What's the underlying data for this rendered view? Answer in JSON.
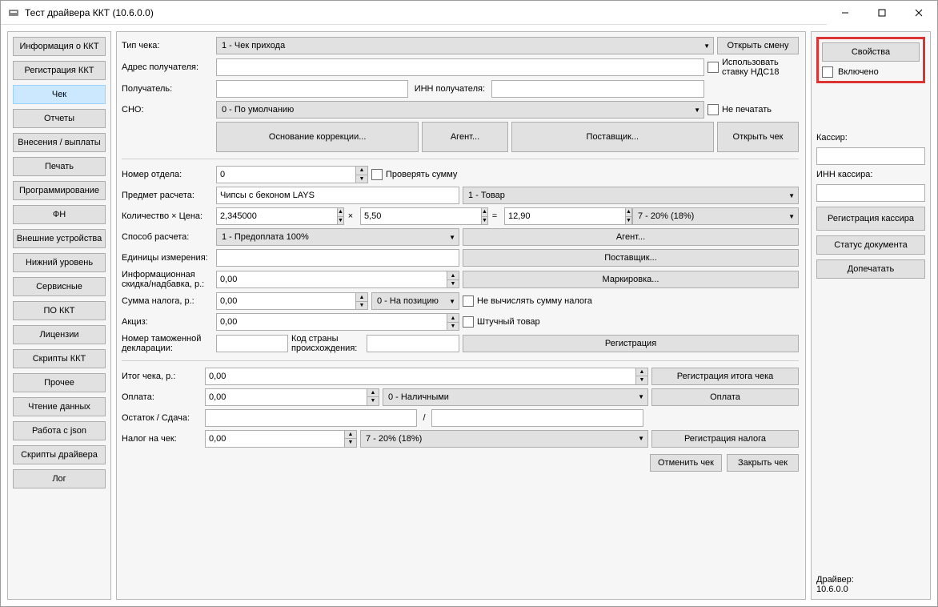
{
  "window": {
    "title": "Тест драйвера ККТ (10.6.0.0)"
  },
  "sidebar": {
    "items": [
      "Информация о ККТ",
      "Регистрация ККТ",
      "Чек",
      "Отчеты",
      "Внесения / выплаты",
      "Печать",
      "Программирование",
      "ФН",
      "Внешние устройства",
      "Нижний уровень",
      "Сервисные",
      "ПО ККТ",
      "Лицензии",
      "Скрипты ККТ",
      "Прочее",
      "Чтение данных",
      "Работа с json",
      "Скрипты драйвера",
      "Лог"
    ],
    "active_index": 2
  },
  "main": {
    "labels": {
      "check_type": "Тип чека:",
      "recipient_address": "Адрес получателя:",
      "recipient": "Получатель:",
      "recipient_inn": "ИНН получателя:",
      "sno": "СНО:",
      "use_vat18": "Использовать ставку НДС18",
      "no_print": "Не печатать",
      "dept_number": "Номер отдела:",
      "check_sum": "Проверять сумму",
      "item_subject": "Предмет расчета:",
      "qty_price": "Количество × Цена:",
      "calc_method": "Способ расчета:",
      "units": "Единицы измерения:",
      "info_discount": "Информационная скидка/надбавка, р.:",
      "tax_sum": "Сумма налога, р.:",
      "no_calc_tax": "Не вычислять сумму налога",
      "excise": "Акциз:",
      "piece_goods": "Штучный товар",
      "customs_decl": "Номер таможенной декларации:",
      "country_code": "Код страны происхождения:",
      "check_total": "Итог чека, р.:",
      "payment": "Оплата:",
      "remainder": "Остаток / Сдача:",
      "check_tax": "Налог на чек:"
    },
    "values": {
      "check_type": "1 - Чек прихода",
      "recipient_address": "",
      "recipient": "",
      "recipient_inn": "",
      "sno": "0 - По умолчанию",
      "dept_number": "0",
      "item_subject": "Чипсы с беконом LAYS",
      "item_type": "1 - Товар",
      "quantity": "2,345000",
      "price": "5,50",
      "total": "12,90",
      "vat_rate": "7 - 20% (18%)",
      "calc_method": "1 - Предоплата 100%",
      "units": "",
      "info_discount": "0,00",
      "tax_sum": "0,00",
      "tax_pos": "0 - На позицию",
      "excise": "0,00",
      "customs_decl": "",
      "country_code": "",
      "check_total": "0,00",
      "payment": "0,00",
      "payment_type": "0 - Наличными",
      "remainder1": "",
      "remainder2": "",
      "check_tax": "0,00",
      "check_tax_type": "7 - 20% (18%)"
    },
    "buttons": {
      "open_shift": "Открыть смену",
      "correction_basis": "Основание коррекции...",
      "agent_top": "Агент...",
      "supplier_top": "Поставщик...",
      "open_check": "Открыть чек",
      "agent_mid": "Агент...",
      "supplier_mid": "Поставщик...",
      "marking": "Маркировка...",
      "registration": "Регистрация",
      "reg_check_total": "Регистрация итога чека",
      "payment_btn": "Оплата",
      "reg_tax": "Регистрация налога",
      "cancel_check": "Отменить чек",
      "close_check": "Закрыть чек"
    },
    "symbols": {
      "mult": "×",
      "eq": "=",
      "slash": "/"
    }
  },
  "rightbar": {
    "properties_btn": "Свойства",
    "enabled_label": "Включено",
    "cashier_label": "Кассир:",
    "cashier_value": "",
    "cashier_inn_label": "ИНН кассира:",
    "cashier_inn_value": "",
    "reg_cashier_btn": "Регистрация кассира",
    "doc_status_btn": "Статус документа",
    "reprint_btn": "Допечатать",
    "driver_label": "Драйвер:",
    "driver_version": "10.6.0.0"
  }
}
